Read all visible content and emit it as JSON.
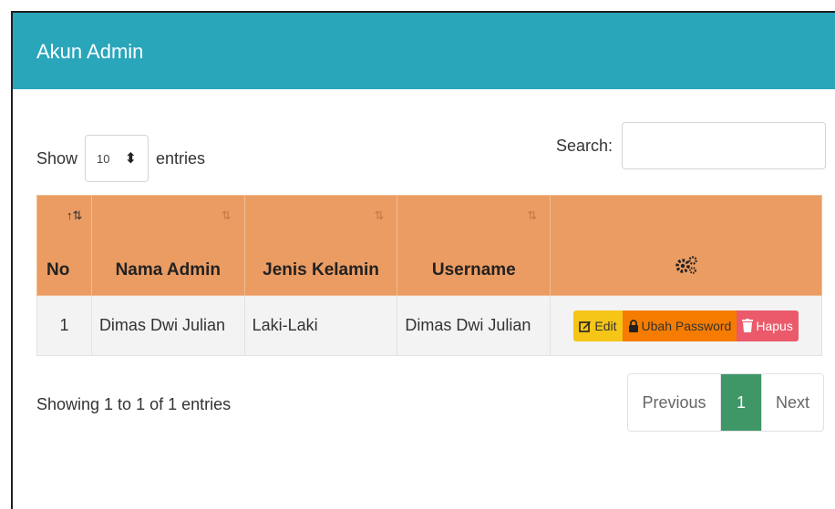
{
  "card": {
    "title": "Akun Admin"
  },
  "length": {
    "show_label": "Show",
    "value": "10",
    "entries_label": "entries"
  },
  "search": {
    "label": "Search:",
    "placeholder": ""
  },
  "table": {
    "columns": [
      "No",
      "Nama Admin",
      "Jenis Kelamin",
      "Username",
      ""
    ],
    "actions_header_icon": "gears-icon",
    "rows": [
      {
        "no": "1",
        "nama": "Dimas Dwi Julian",
        "jk": "Laki-Laki",
        "username": "Dimas Dwi Julian"
      }
    ],
    "actions": {
      "edit": "Edit",
      "password": "Ubah Password",
      "delete": "Hapus"
    }
  },
  "info": "Showing 1 to 1 of 1 entries",
  "pagination": {
    "previous": "Previous",
    "current": "1",
    "next": "Next"
  },
  "colors": {
    "header": "#2aa6bb",
    "table_head": "#eb9c62",
    "edit": "#f5c518",
    "password": "#f57c00",
    "delete": "#ea5a6b",
    "page_active": "#3f9767"
  }
}
